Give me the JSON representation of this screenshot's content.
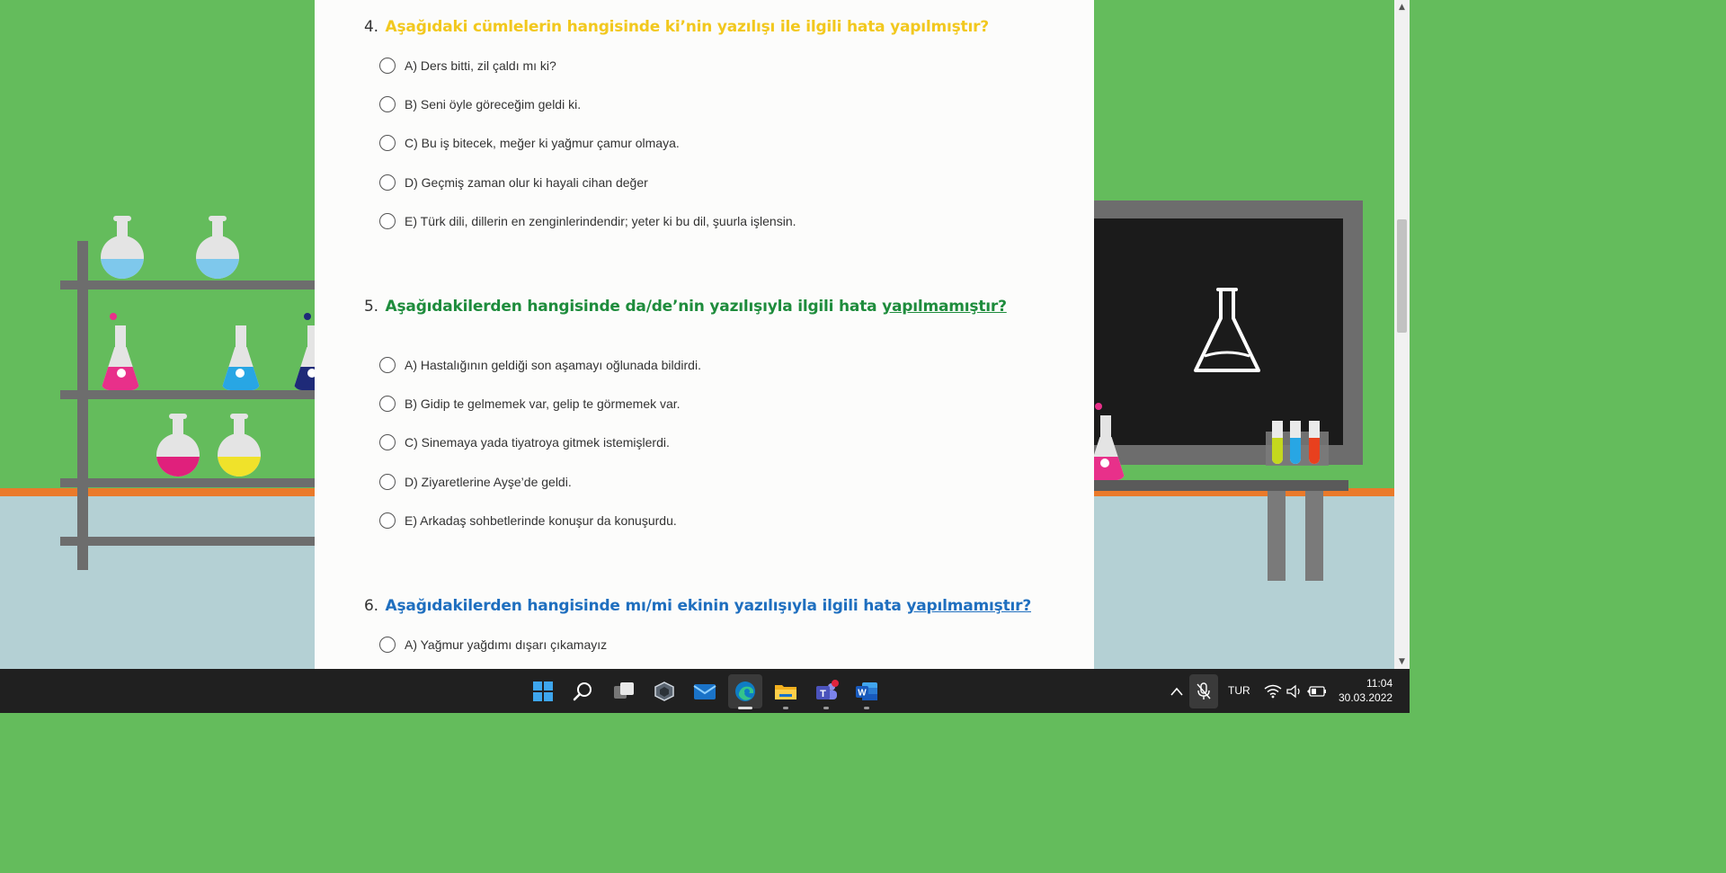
{
  "questions": [
    {
      "number": "4.",
      "text": "Aşağıdaki cümlelerin hangisinde ki’nin yazılışı ile ilgili hata yapılmıştır?",
      "underlined": "",
      "color": "#f2c81e",
      "options": [
        "A) Ders bitti, zil çaldı mı ki?",
        "B) Seni öyle göreceğim geldi ki.",
        "C) Bu iş bitecek, meğer ki yağmur çamur olmaya.",
        "D) Geçmiş zaman olur ki hayali cihan değer",
        "E) Türk dili, dillerin en zenginlerindendir; yeter ki bu dil, şuurla işlensin."
      ]
    },
    {
      "number": "5.",
      "text": "Aşağıdakilerden hangisinde da/de’nin yazılışıyla ilgili hata ",
      "underlined": "yapılmamıştır?",
      "color": "#1e8c3c",
      "options": [
        "A) Hastalığının geldiği son aşamayı oğlunada bildirdi.",
        "B) Gidip te gelmemek var, gelip te görmemek var.",
        "C) Sinemaya yada tiyatroya gitmek istemişlerdi.",
        "D) Ziyaretlerine Ayşe’de geldi.",
        "E) Arkadaş sohbetlerinde konuşur da konuşurdu."
      ]
    },
    {
      "number": "6.",
      "text": "Aşağıdakilerden hangisinde mı/mi ekinin yazılışıyla ilgili hata ",
      "underlined": "yapılmamıştır?",
      "color": "#1f6fbf",
      "options": [
        "A) Yağmur yağdımı dışarı çıkamayız"
      ]
    }
  ],
  "taskbar": {
    "apps": [
      "start-icon",
      "search-icon",
      "task-view-icon",
      "app-icon",
      "mail-icon",
      "edge-icon",
      "file-explorer-icon",
      "teams-icon",
      "word-icon"
    ],
    "language": "TUR",
    "time": "11:04",
    "date": "30.03.2022"
  },
  "colors": {
    "wall": "#64bc5c",
    "panel": "#fcfcfb",
    "taskbar": "#202020"
  }
}
